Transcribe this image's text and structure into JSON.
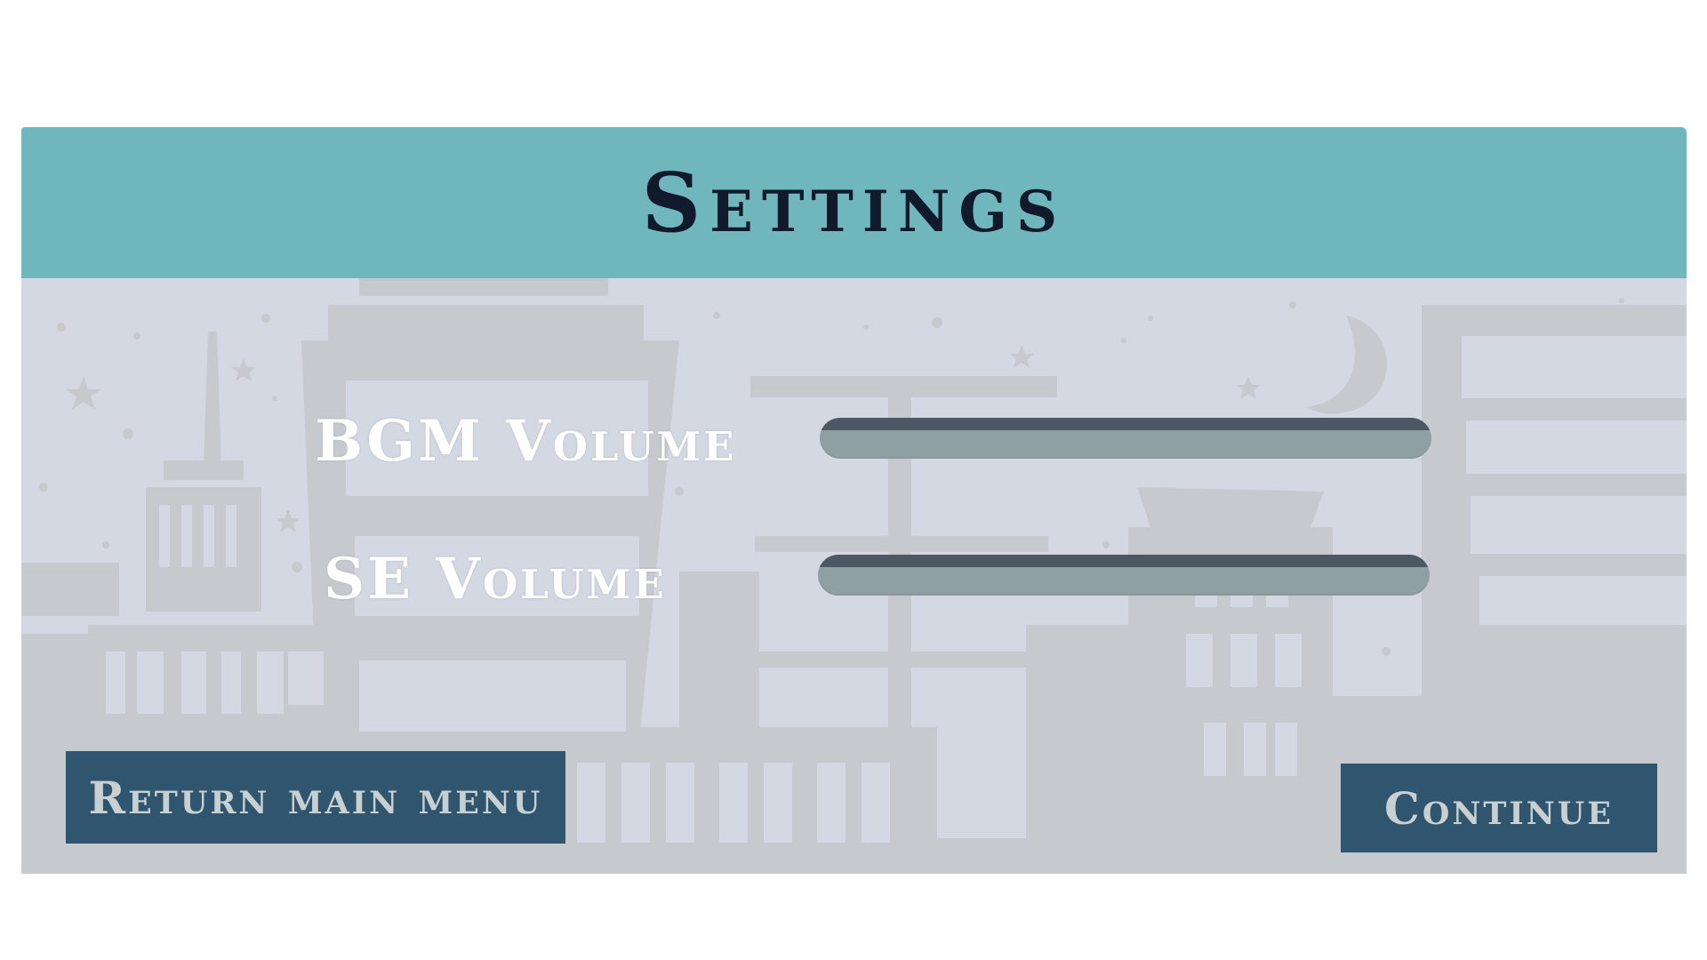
{
  "settings": {
    "title": "Settings",
    "bgm_label": "BGM Volume",
    "se_label": "SE Volume",
    "bgm_level": 1.0,
    "se_level": 1.0,
    "return_label": "Return main menu",
    "continue_label": "Continue"
  },
  "colors": {
    "header": "#6fb7bd",
    "title_text": "#111a2c",
    "background": "#d3d8e2",
    "buildings": "#c6cace",
    "slider_track": "#8fa0a3",
    "slider_rim": "#4d5864",
    "button": "#30566f",
    "button_text": "#c8d0d2"
  },
  "background": {
    "scene": "city-skyline-night-icon",
    "moon": "crescent-moon-icon",
    "stars": "star-icon"
  }
}
